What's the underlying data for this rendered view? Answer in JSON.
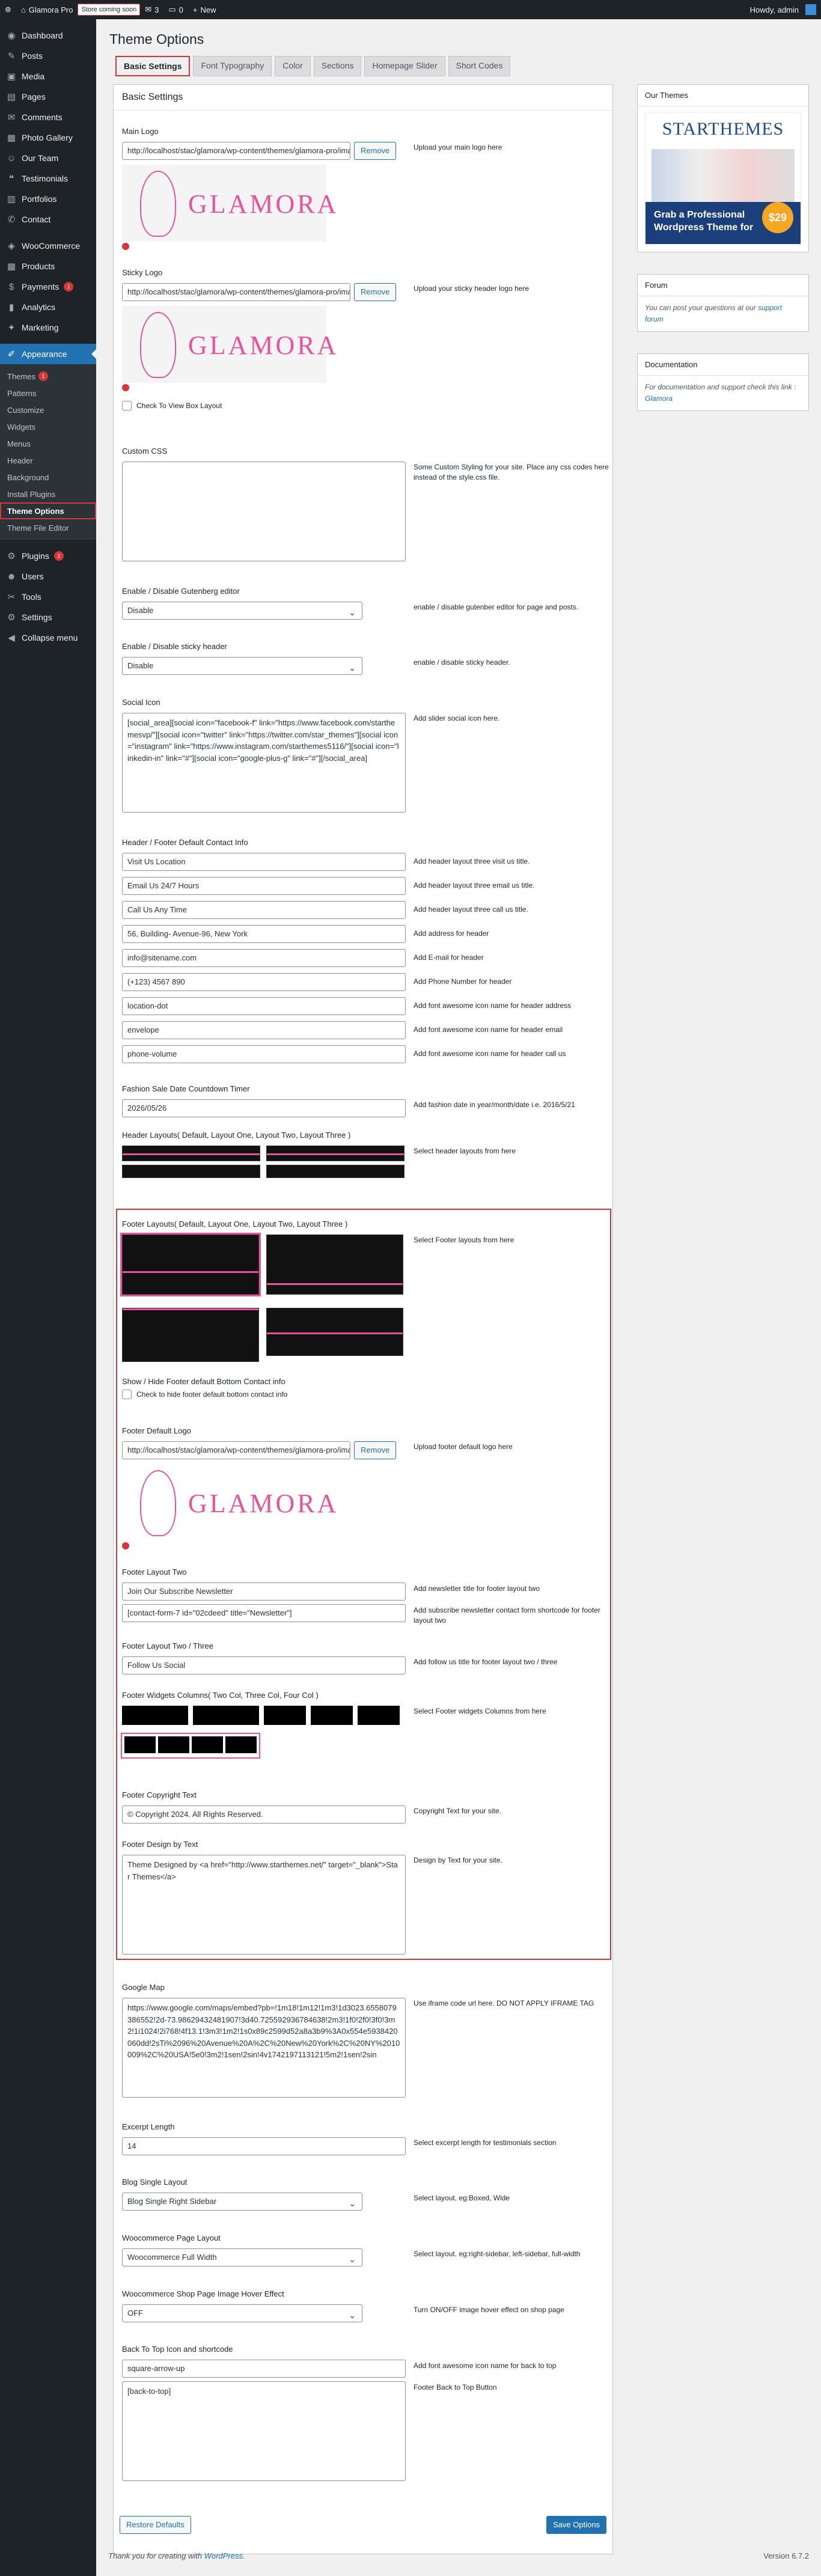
{
  "adminbar": {
    "site_name": "Glamora Pro",
    "coming_soon": "Store coming soon",
    "comments_count": "3",
    "updates_count": "0",
    "new_label": "New",
    "howdy": "Howdy, admin"
  },
  "sidebar": {
    "items": [
      {
        "label": "Dashboard",
        "icon": "dashboard-icon",
        "glyph": "◉"
      },
      {
        "label": "Posts",
        "icon": "pin-icon",
        "glyph": "✎"
      },
      {
        "label": "Media",
        "icon": "media-icon",
        "glyph": "▣"
      },
      {
        "label": "Pages",
        "icon": "page-icon",
        "glyph": "▤"
      },
      {
        "label": "Comments",
        "icon": "comment-icon",
        "glyph": "✉"
      },
      {
        "label": "Photo Gallery",
        "icon": "gallery-icon",
        "glyph": "▦"
      },
      {
        "label": "Our Team",
        "icon": "team-icon",
        "glyph": "☺"
      },
      {
        "label": "Testimonials",
        "icon": "quote-icon",
        "glyph": "❝"
      },
      {
        "label": "Portfolios",
        "icon": "portfolio-icon",
        "glyph": "▥"
      },
      {
        "label": "Contact",
        "icon": "contact-icon",
        "glyph": "✆"
      }
    ],
    "items2": [
      {
        "label": "WooCommerce",
        "icon": "woo-icon",
        "glyph": "◈"
      },
      {
        "label": "Products",
        "icon": "products-icon",
        "glyph": "▩"
      },
      {
        "label": "Payments",
        "icon": "payments-icon",
        "glyph": "$",
        "count": "1"
      },
      {
        "label": "Analytics",
        "icon": "analytics-icon",
        "glyph": "▮"
      },
      {
        "label": "Marketing",
        "icon": "marketing-icon",
        "glyph": "✦"
      }
    ],
    "appearance": {
      "label": "Appearance",
      "icon": "brush-icon",
      "glyph": "✐"
    },
    "submenu": [
      {
        "label": "Themes",
        "count": "1"
      },
      {
        "label": "Patterns"
      },
      {
        "label": "Customize"
      },
      {
        "label": "Widgets"
      },
      {
        "label": "Menus"
      },
      {
        "label": "Header"
      },
      {
        "label": "Background"
      },
      {
        "label": "Install Plugins"
      },
      {
        "label": "Theme Options",
        "current": true
      },
      {
        "label": "Theme File Editor"
      }
    ],
    "items3": [
      {
        "label": "Plugins",
        "icon": "plugin-icon",
        "glyph": "⚙",
        "count": "2"
      },
      {
        "label": "Users",
        "icon": "users-icon",
        "glyph": "☻"
      },
      {
        "label": "Tools",
        "icon": "tools-icon",
        "glyph": "✂"
      },
      {
        "label": "Settings",
        "icon": "settings-icon",
        "glyph": "⚙"
      },
      {
        "label": "Collapse menu",
        "icon": "collapse-icon",
        "glyph": "◀"
      }
    ]
  },
  "page": {
    "title": "Theme Options",
    "tabs": [
      "Basic Settings",
      "Font Typography",
      "Color",
      "Sections",
      "Homepage Slider",
      "Short Codes"
    ],
    "panel_title": "Basic Settings"
  },
  "fields": {
    "main_logo": {
      "label": "Main Logo",
      "value": "http://localhost/stac/glamora/wp-content/themes/glamora-pro/images/logo.png",
      "remove": "Remove",
      "desc": "Upload your main logo here"
    },
    "sticky_logo": {
      "label": "Sticky Logo",
      "value": "http://localhost/stac/glamora/wp-content/themes/glamora-pro/images/logo.png",
      "remove": "Remove",
      "desc": "Upload your sticky header logo here"
    },
    "logo_text": "GLAMORA",
    "box_layout": "Check To View Box Layout",
    "custom_css": {
      "label": "Custom CSS",
      "desc": "Some Custom Styling for your site. Place any css codes here instead of the style.css file."
    },
    "gutenberg": {
      "label": "Enable / Disable Gutenberg editor",
      "value": "Disable",
      "desc": "enable / disable gutenber editor for page and posts."
    },
    "sticky_header": {
      "label": "Enable / Disable sticky header",
      "value": "Disable",
      "desc": "enable / disable sticky header."
    },
    "social": {
      "label": "Social Icon",
      "value": "[social_area][social icon=\"facebook-f\" link=\"https://www.facebook.com/starthemesvp/\"][social icon=\"twitter\" link=\"https://twitter.com/star_themes\"][social icon=\"instagram\" link=\"https://www.instagram.com/starthemes5116/\"][social icon=\"linkedin-in\" link=\"#\"][social icon=\"google-plus-g\" link=\"#\"][/social_area]",
      "desc": "Add slider social icon here."
    },
    "contact_info": {
      "label": "Header / Footer Default Contact Info",
      "rows": [
        {
          "value": "Visit Us Location",
          "desc": "Add header layout three visit us title."
        },
        {
          "value": "Email Us 24/7 Hours",
          "desc": "Add header layout three email us title."
        },
        {
          "value": "Call Us Any Time",
          "desc": "Add header layout three call us title."
        },
        {
          "value": "56, Building- Avenue-96, New York",
          "desc": "Add address for header"
        },
        {
          "value": "info@sitename.com",
          "desc": "Add E-mail for header"
        },
        {
          "value": "(+123) 4567 890",
          "desc": "Add Phone Number for header"
        },
        {
          "value": "location-dot",
          "desc": "Add font awesome icon name for header address"
        },
        {
          "value": "envelope",
          "desc": "Add font awesome icon name for header email"
        },
        {
          "value": "phone-volume",
          "desc": "Add font awesome icon name for header call us"
        }
      ]
    },
    "countdown": {
      "label": "Fashion Sale Date Countdown Timer",
      "value": "2026/05/26",
      "desc": "Add fashion date in year/month/date i.e. 2016/5/21"
    },
    "header_layouts": {
      "label": "Header Layouts( Default, Layout One, Layout Two, Layout Three )",
      "desc": "Select header layouts from here"
    },
    "footer_layouts": {
      "label": "Footer Layouts( Default, Layout One, Layout Two, Layout Three )",
      "desc": "Select Footer layouts from here"
    },
    "footer_contact": {
      "label": "Show / Hide Footer default Bottom Contact info",
      "check": "Check to hide footer default bottom contact info"
    },
    "footer_logo": {
      "label": "Footer Default Logo",
      "value": "http://localhost/stac/glamora/wp-content/themes/glamora-pro/images/logo.png",
      "remove": "Remove",
      "desc": "Upload footer default logo here"
    },
    "footer_two": {
      "label": "Footer Layout Two",
      "title": "Join Our Subscribe Newsletter",
      "title_desc": "Add newsletter title for footer layout two",
      "shortcode": "[contact-form-7 id=\"02cdeed\" title=\"Newsletter\"]",
      "shortcode_desc": "Add subscribe newsletter contact form shortcode for footer layout two"
    },
    "footer_two_three": {
      "label": "Footer Layout Two / Three",
      "value": "Follow Us Social",
      "desc": "Add follow us title for footer layout two / three"
    },
    "widget_cols": {
      "label": "Footer Widgets Columns( Two Col, Three Col, Four Col )",
      "desc": "Select Footer widgets Columns from here"
    },
    "copyright": {
      "label": "Footer Copyright Text",
      "value": "© Copyright 2024. All Rights Reserved.",
      "desc": "Copyright Text for your site."
    },
    "design_by": {
      "label": "Footer Design by Text",
      "value": "Theme Designed by <a href=\"http://www.starthemes.net/\" target=\"_blank\">Star Themes</a>",
      "desc": "Design by Text for your site."
    },
    "google_map": {
      "label": "Google Map",
      "value": "https://www.google.com/maps/embed?pb=!1m18!1m12!1m3!1d3023.6558079386552!2d-73.98629432481907!3d40.725592936784638!2m3!1f0!2f0!3f0!3m2!1i1024!2i768!4f13.1!3m3!1m2!1s0x89c2599d52a8a3b9%3A0x554e5938420060dd!2sTi%2096%20Avenue%20A%2C%20New%20York%2C%20NY%2010009%2C%20USA!5e0!3m2!1sen!2sin!4v1742197113121!5m2!1sen!2sin",
      "desc": "Use iframe code url here. DO NOT APPLY IFRAME TAG"
    },
    "excerpt": {
      "label": "Excerpt Length",
      "value": "14",
      "desc": "Select excerpt length for testimonials section"
    },
    "blog_layout": {
      "label": "Blog Single Layout",
      "value": "Blog Single Right Sidebar",
      "desc": "Select layout. eg:Boxed, Wide"
    },
    "woo_layout": {
      "label": "Woocommerce Page Layout",
      "value": "Woocommerce Full Width",
      "desc": "Select layout. eg:right-sidebar, left-sidebar, full-width"
    },
    "woo_hover": {
      "label": "Woocommerce Shop Page Image Hover Effect",
      "value": "OFF",
      "desc": "Turn ON/OFF image hover effect on shop page"
    },
    "back_top": {
      "label": "Back To Top Icon and shortcode",
      "value": "square-arrow-up",
      "desc": "Add font awesome icon name for back to top",
      "shortcode": "[back-to-top]",
      "shortcode_desc": "Footer Back to Top Button"
    }
  },
  "buttons": {
    "restore": "Restore Defaults",
    "save": "Save Options"
  },
  "right": {
    "our_themes": "Our Themes",
    "ad_brand": "STARTHEMES",
    "ad_cta": "Grab a Professional Wordpress Theme for",
    "ad_price": "$29",
    "forum_title": "Forum",
    "forum_text": "You can post your questions at our",
    "forum_link": "support forum",
    "doc_title": "Documentation",
    "doc_text": "For documentation and support check this link :",
    "doc_link": "Glamora"
  },
  "footer": {
    "thanks": "Thank you for creating with",
    "wp": "WordPress.",
    "version": "Version 6.7.2"
  },
  "colors": {
    "accent": "#2271b1",
    "highlight": "#d63638",
    "brand_pink": "#e8549b"
  }
}
